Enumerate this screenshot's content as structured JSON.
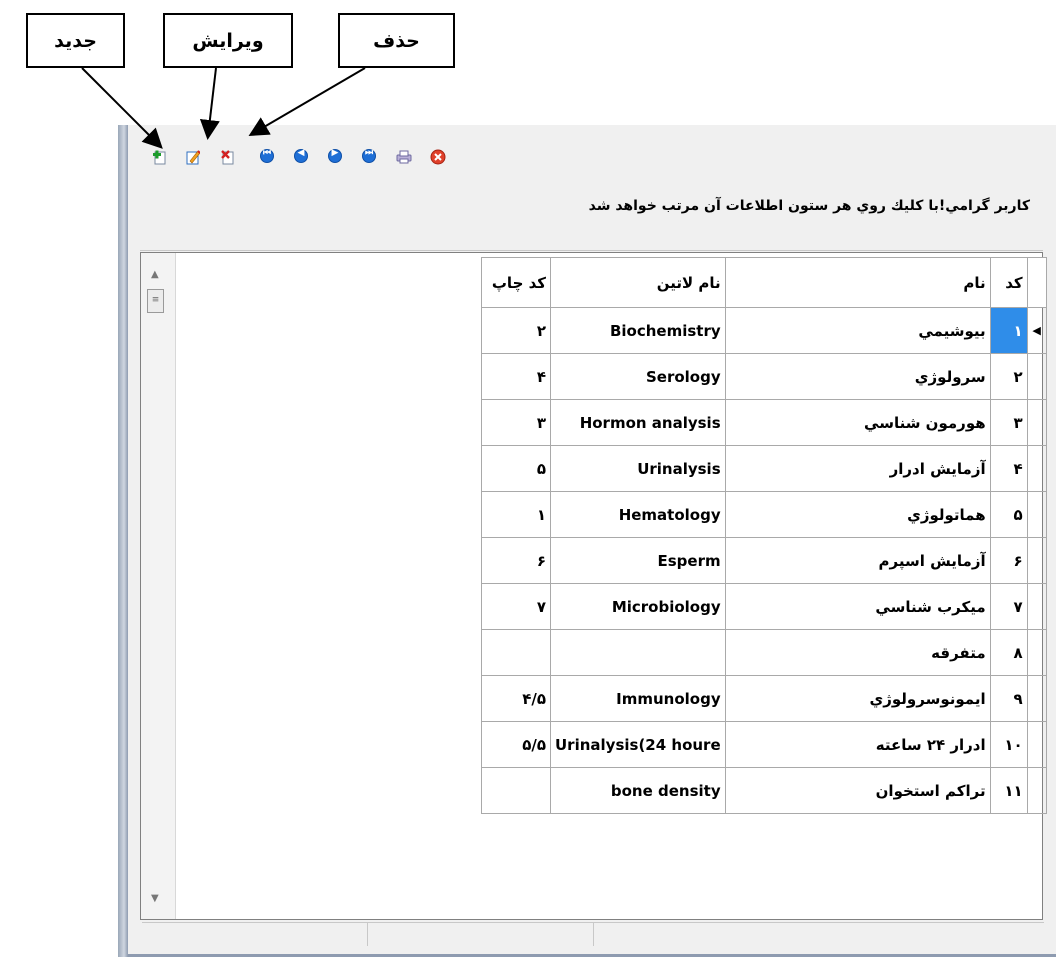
{
  "callouts": {
    "new_label": "جديد",
    "edit_label": "ويرايش",
    "delete_label": "حذف"
  },
  "toolbar": {
    "buttons": [
      "add-record-icon",
      "edit-record-icon",
      "delete-record-icon",
      "first-record-icon",
      "prev-record-icon",
      "next-record-icon",
      "last-record-icon",
      "print-icon",
      "close-icon"
    ]
  },
  "hint": "كاربر گرامي!با كليك روي هر ستون اطلاعات آن مرتب خواهد شد",
  "table": {
    "headers": {
      "code": "كد",
      "name": "نام",
      "latin": "نام لاتين",
      "print_code": "كد چاپ"
    },
    "rows": [
      {
        "code": "١",
        "name": "بيوشيمي",
        "latin": "Biochemistry",
        "print": "٢"
      },
      {
        "code": "٢",
        "name": "سرولوژي",
        "latin": "Serology",
        "print": "۴"
      },
      {
        "code": "٣",
        "name": "هورمون شناسي",
        "latin": "Hormon analysis",
        "print": "٣"
      },
      {
        "code": "۴",
        "name": "آزمايش ادرار",
        "latin": "Urinalysis",
        "print": "۵"
      },
      {
        "code": "۵",
        "name": "هماتولوژي",
        "latin": "Hematology",
        "print": "١"
      },
      {
        "code": "۶",
        "name": "آزمايش اسپرم",
        "latin": "Esperm",
        "print": "۶"
      },
      {
        "code": "٧",
        "name": "ميكرب شناسي",
        "latin": "Microbiology",
        "print": "٧"
      },
      {
        "code": "٨",
        "name": "متفرقه",
        "latin": "",
        "print": ""
      },
      {
        "code": "٩",
        "name": "ايمونوسرولوژي",
        "latin": "Immunology",
        "print": "۴/۵"
      },
      {
        "code": "١٠",
        "name": "ادرار ٢۴ ساعته",
        "latin": "Urinalysis(24 houre",
        "print": "۵/۵"
      },
      {
        "code": "١١",
        "name": "تراكم استخوان",
        "latin": "bone density",
        "print": ""
      }
    ]
  }
}
